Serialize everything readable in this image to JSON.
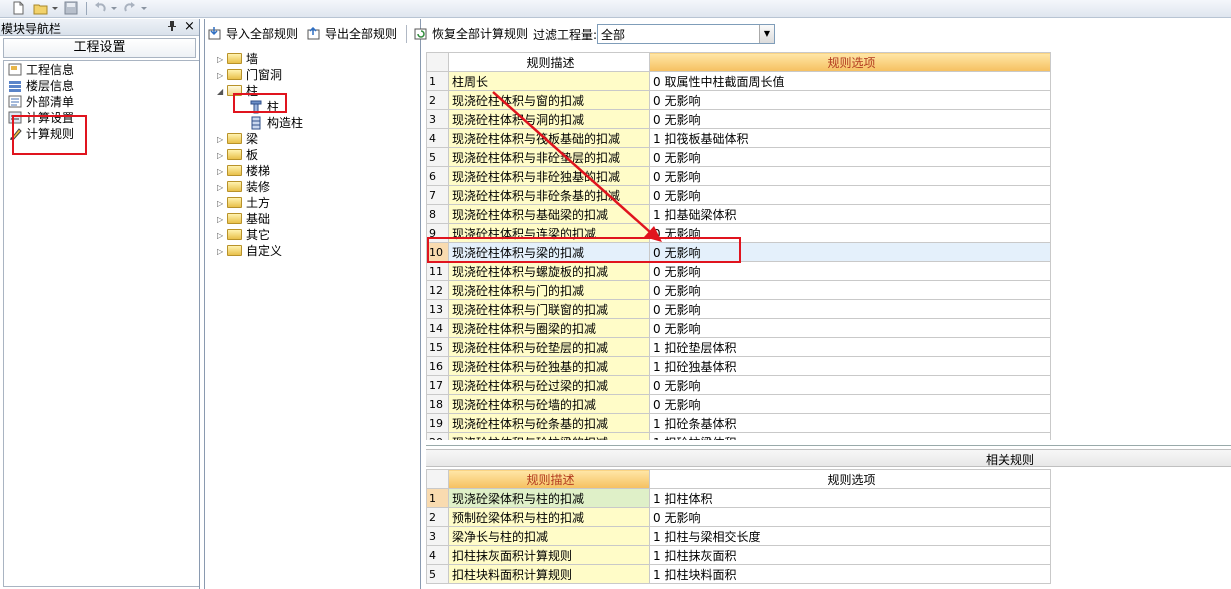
{
  "nav": {
    "title": "模块导航栏",
    "pin": "ꟷ",
    "close": "×",
    "header": "工程设置",
    "items": [
      {
        "label": "工程信息",
        "icon": "project-info-icon"
      },
      {
        "label": "楼层信息",
        "icon": "floor-info-icon"
      },
      {
        "label": "外部清单",
        "icon": "external-list-icon"
      },
      {
        "label": "计算设置",
        "icon": "calc-settings-icon"
      },
      {
        "label": "计算规则",
        "icon": "calc-rules-icon"
      }
    ]
  },
  "tree": {
    "nodes": [
      {
        "label": "墙",
        "arrow": "▷"
      },
      {
        "label": "门窗洞",
        "arrow": "▷"
      },
      {
        "label": "柱",
        "arrow": "◢"
      },
      {
        "label": "柱",
        "arrow": ""
      },
      {
        "label": "构造柱",
        "arrow": ""
      },
      {
        "label": "梁",
        "arrow": "▷"
      },
      {
        "label": "板",
        "arrow": "▷"
      },
      {
        "label": "楼梯",
        "arrow": "▷"
      },
      {
        "label": "装修",
        "arrow": "▷"
      },
      {
        "label": "土方",
        "arrow": "▷"
      },
      {
        "label": "基础",
        "arrow": "▷"
      },
      {
        "label": "其它",
        "arrow": "▷"
      },
      {
        "label": "自定义",
        "arrow": "▷"
      }
    ]
  },
  "toolbar": {
    "import_label": "导入全部规则",
    "export_label": "导出全部规则",
    "restore_label": "恢复全部计算规则",
    "filter_label": "过滤工程量:",
    "filter_value": "全部",
    "dropdown_arrow": "▼"
  },
  "rules_grid": {
    "header_desc": "规则描述",
    "header_opt": "规则选项",
    "selected_row": 10,
    "rows": [
      {
        "n": "1",
        "desc": "柱周长",
        "opt": "0 取属性中柱截面周长值"
      },
      {
        "n": "2",
        "desc": "现浇砼柱体积与窗的扣减",
        "opt": "0  无影响"
      },
      {
        "n": "3",
        "desc": "现浇砼柱体积与洞的扣减",
        "opt": "0  无影响"
      },
      {
        "n": "4",
        "desc": "现浇砼柱体积与筏板基础的扣减",
        "opt": "1 扣筏板基础体积"
      },
      {
        "n": "5",
        "desc": "现浇砼柱体积与非砼垫层的扣减",
        "opt": "0  无影响"
      },
      {
        "n": "6",
        "desc": "现浇砼柱体积与非砼独基的扣减",
        "opt": "0  无影响"
      },
      {
        "n": "7",
        "desc": "现浇砼柱体积与非砼条基的扣减",
        "opt": "0  无影响"
      },
      {
        "n": "8",
        "desc": "现浇砼柱体积与基础梁的扣减",
        "opt": "1 扣基础梁体积"
      },
      {
        "n": "9",
        "desc": "现浇砼柱体积与连梁的扣减",
        "opt": "0  无影响"
      },
      {
        "n": "10",
        "desc": "现浇砼柱体积与梁的扣减",
        "opt": "0  无影响"
      },
      {
        "n": "11",
        "desc": "现浇砼柱体积与螺旋板的扣减",
        "opt": "0  无影响"
      },
      {
        "n": "12",
        "desc": "现浇砼柱体积与门的扣减",
        "opt": "0  无影响"
      },
      {
        "n": "13",
        "desc": "现浇砼柱体积与门联窗的扣减",
        "opt": "0  无影响"
      },
      {
        "n": "14",
        "desc": "现浇砼柱体积与圈梁的扣减",
        "opt": "0  无影响"
      },
      {
        "n": "15",
        "desc": "现浇砼柱体积与砼垫层的扣减",
        "opt": "1 扣砼垫层体积"
      },
      {
        "n": "16",
        "desc": "现浇砼柱体积与砼独基的扣减",
        "opt": "1 扣砼独基体积"
      },
      {
        "n": "17",
        "desc": "现浇砼柱体积与砼过梁的扣减",
        "opt": "0  无影响"
      },
      {
        "n": "18",
        "desc": "现浇砼柱体积与砼墙的扣减",
        "opt": "0  无影响"
      },
      {
        "n": "19",
        "desc": "现浇砼柱体积与砼条基的扣减",
        "opt": "1 扣砼条基体积"
      },
      {
        "n": "20",
        "desc": "现浇砼柱体积与砼拉梁的扣减",
        "opt": "1 扣砼拉梁体积"
      }
    ]
  },
  "related": {
    "title": "相关规则",
    "header_desc": "规则描述",
    "header_opt": "规则选项",
    "rows": [
      {
        "n": "1",
        "desc": "现浇砼梁体积与柱的扣减",
        "opt": "1 扣柱体积"
      },
      {
        "n": "2",
        "desc": "预制砼梁体积与柱的扣减",
        "opt": "0  无影响"
      },
      {
        "n": "3",
        "desc": "梁净长与柱的扣减",
        "opt": "1 扣柱与梁相交长度"
      },
      {
        "n": "4",
        "desc": "扣柱抹灰面积计算规则",
        "opt": "1 扣柱抹灰面积"
      },
      {
        "n": "5",
        "desc": "扣柱块料面积计算规则",
        "opt": "1 扣柱块料面积"
      }
    ]
  },
  "annotation_color": "#e0141e"
}
